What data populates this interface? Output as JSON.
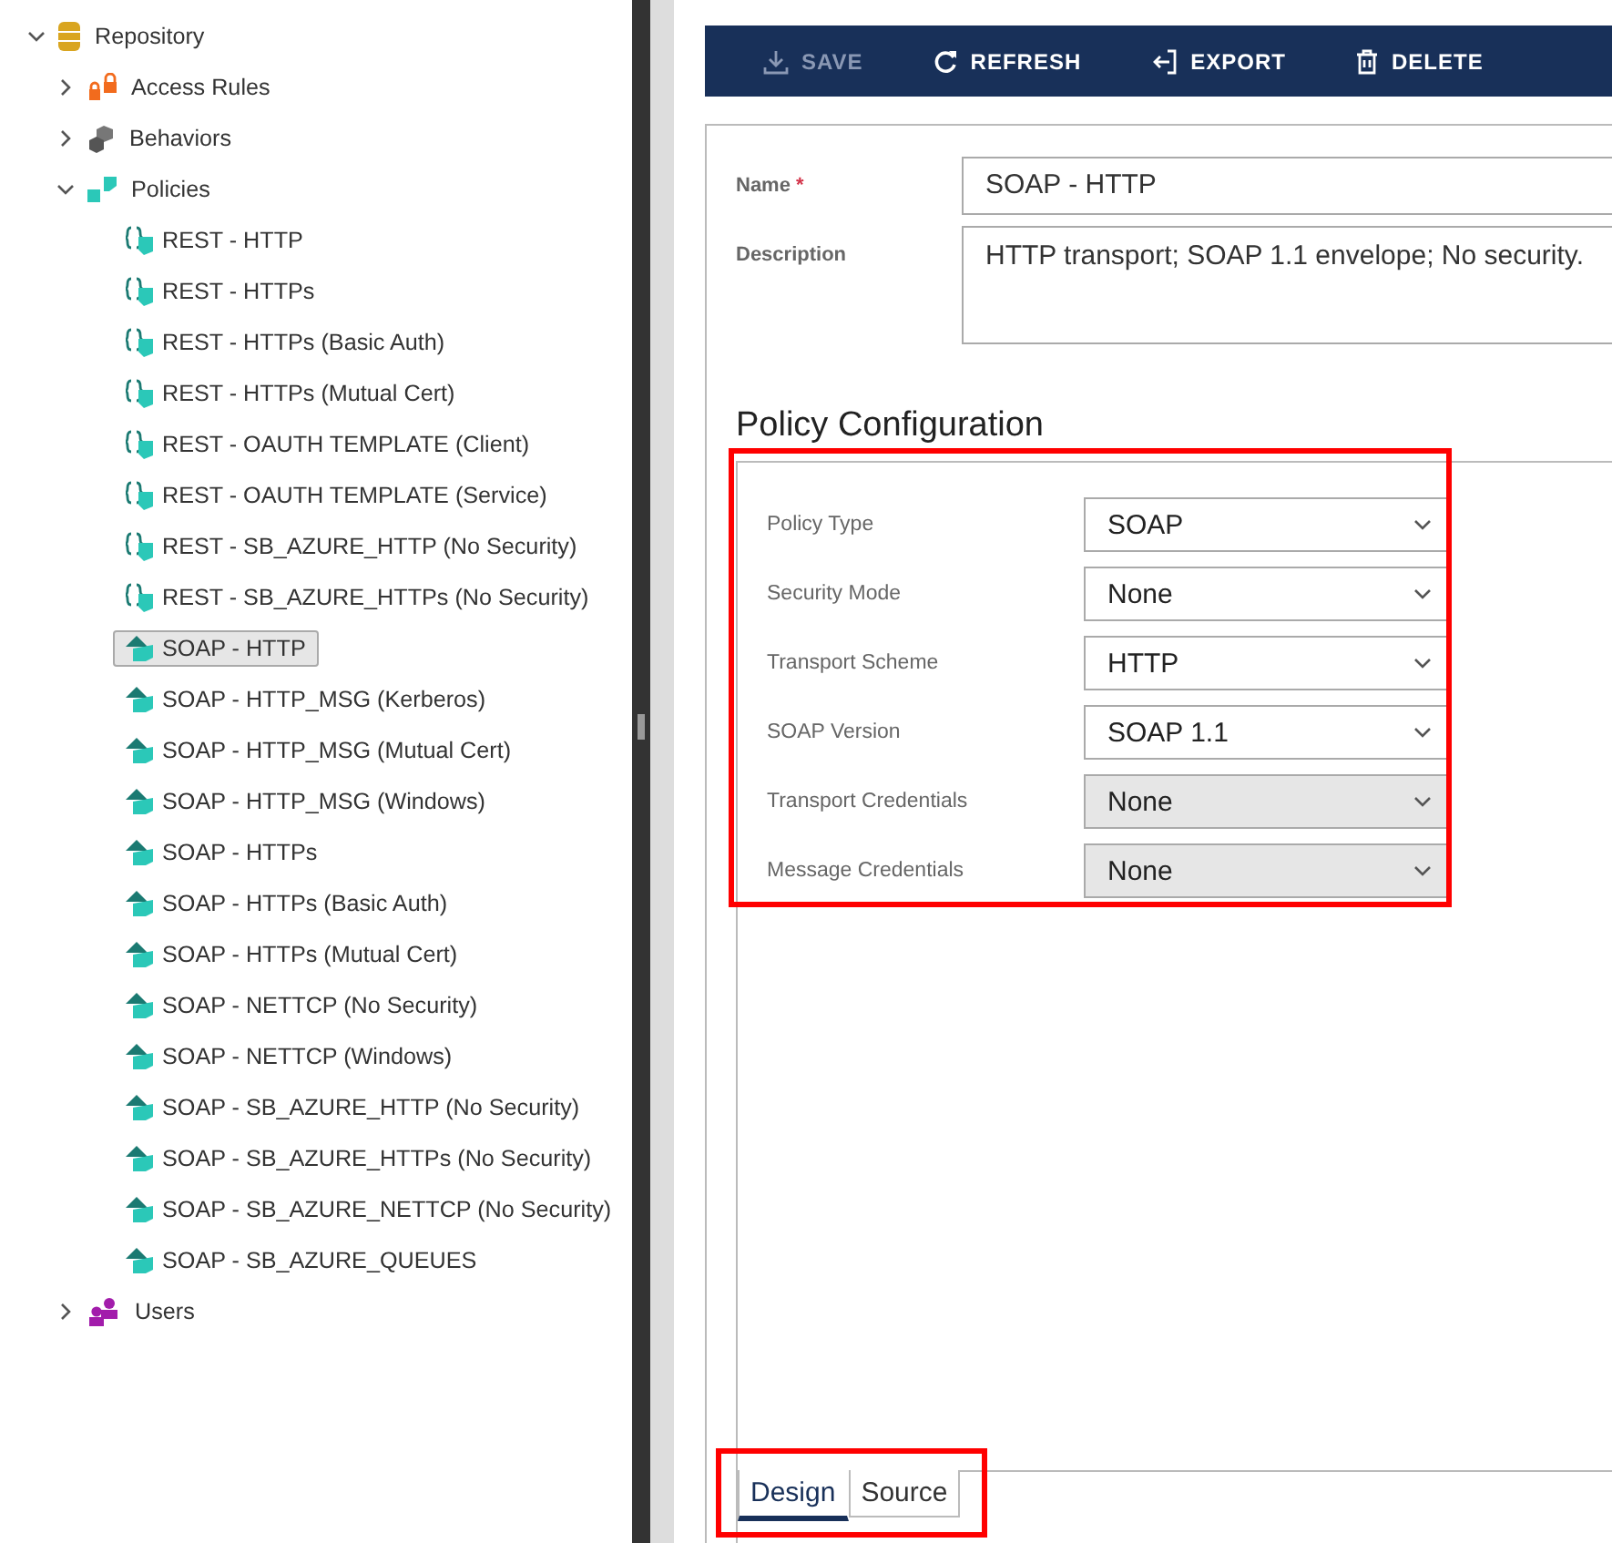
{
  "tree": [
    {
      "label": "Repository",
      "kind": "database",
      "expanded": true,
      "children": [
        {
          "label": "Access Rules",
          "kind": "lock",
          "expanded": false
        },
        {
          "label": "Behaviors",
          "kind": "cubes",
          "expanded": false
        },
        {
          "label": "Policies",
          "kind": "policies",
          "expanded": true,
          "children": [
            {
              "label": "REST - HTTP",
              "kind": "rest",
              "selected": false
            },
            {
              "label": "REST - HTTPs",
              "kind": "rest",
              "selected": false
            },
            {
              "label": "REST - HTTPs (Basic Auth)",
              "kind": "rest",
              "selected": false
            },
            {
              "label": "REST - HTTPs (Mutual Cert)",
              "kind": "rest",
              "selected": false
            },
            {
              "label": "REST - OAUTH TEMPLATE (Client)",
              "kind": "rest",
              "selected": false
            },
            {
              "label": "REST - OAUTH TEMPLATE (Service)",
              "kind": "rest",
              "selected": false
            },
            {
              "label": "REST - SB_AZURE_HTTP (No Security)",
              "kind": "rest",
              "selected": false
            },
            {
              "label": "REST - SB_AZURE_HTTPs (No Security)",
              "kind": "rest",
              "selected": false
            },
            {
              "label": "SOAP - HTTP",
              "kind": "soap",
              "selected": true
            },
            {
              "label": "SOAP - HTTP_MSG (Kerberos)",
              "kind": "soap",
              "selected": false
            },
            {
              "label": "SOAP - HTTP_MSG (Mutual Cert)",
              "kind": "soap",
              "selected": false
            },
            {
              "label": "SOAP - HTTP_MSG (Windows)",
              "kind": "soap",
              "selected": false
            },
            {
              "label": "SOAP - HTTPs",
              "kind": "soap",
              "selected": false
            },
            {
              "label": "SOAP - HTTPs (Basic Auth)",
              "kind": "soap",
              "selected": false
            },
            {
              "label": "SOAP - HTTPs (Mutual Cert)",
              "kind": "soap",
              "selected": false
            },
            {
              "label": "SOAP - NETTCP (No Security)",
              "kind": "soap",
              "selected": false
            },
            {
              "label": "SOAP - NETTCP (Windows)",
              "kind": "soap",
              "selected": false
            },
            {
              "label": "SOAP - SB_AZURE_HTTP (No Security)",
              "kind": "soap",
              "selected": false
            },
            {
              "label": "SOAP - SB_AZURE_HTTPs (No Security)",
              "kind": "soap",
              "selected": false
            },
            {
              "label": "SOAP - SB_AZURE_NETTCP (No Security)",
              "kind": "soap",
              "selected": false
            },
            {
              "label": "SOAP - SB_AZURE_QUEUES",
              "kind": "soap",
              "selected": false
            }
          ]
        },
        {
          "label": "Users",
          "kind": "users",
          "expanded": false
        }
      ]
    }
  ],
  "toolbar": [
    {
      "label": "SAVE",
      "kind": "save",
      "disabled": true
    },
    {
      "label": "REFRESH",
      "kind": "refresh",
      "disabled": false
    },
    {
      "label": "EXPORT",
      "kind": "export",
      "disabled": false
    },
    {
      "label": "DELETE",
      "kind": "delete",
      "disabled": false
    }
  ],
  "form": {
    "name": {
      "label": "Name",
      "required_mark": "*",
      "value": "SOAP - HTTP"
    },
    "description": {
      "label": "Description",
      "value": "HTTP transport; SOAP 1.1 envelope; No security."
    }
  },
  "policy_configuration": {
    "title": "Policy Configuration",
    "highlighted": true,
    "fields": [
      {
        "label": "Policy Type",
        "value": "SOAP",
        "disabled": false
      },
      {
        "label": "Security Mode",
        "value": "None",
        "disabled": false
      },
      {
        "label": "Transport Scheme",
        "value": "HTTP",
        "disabled": false
      },
      {
        "label": "SOAP Version",
        "value": "SOAP 1.1",
        "disabled": false
      },
      {
        "label": "Transport Credentials",
        "value": "None",
        "disabled": true
      },
      {
        "label": "Message Credentials",
        "value": "None",
        "disabled": true
      }
    ]
  },
  "tabs": {
    "highlighted": true,
    "items": [
      {
        "label": "Design",
        "selected": true
      },
      {
        "label": "Source",
        "selected": false
      }
    ]
  }
}
